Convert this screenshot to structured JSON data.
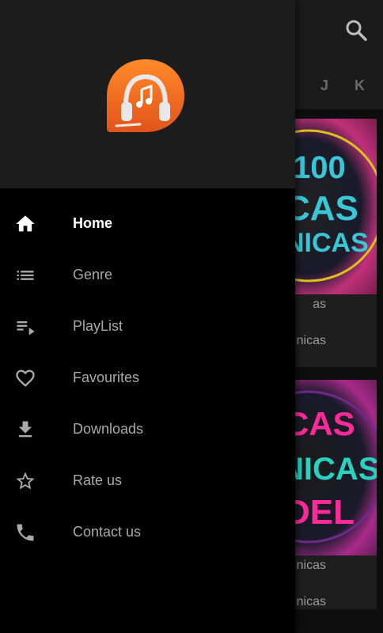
{
  "background": {
    "alphabet": [
      "J",
      "K"
    ],
    "cards": [
      {
        "art_text": "100\nCAS\nNICAS",
        "title": "as",
        "subtitle": "nicas"
      },
      {
        "art_text": "CAS\nNICAS\nDEL",
        "title": "nicas",
        "subtitle": "nicas"
      }
    ]
  },
  "drawer": {
    "nav": [
      {
        "label": "Home",
        "icon": "home-icon",
        "active": true
      },
      {
        "label": "Genre",
        "icon": "list-icon",
        "active": false
      },
      {
        "label": "PlayList",
        "icon": "playlist-icon",
        "active": false
      },
      {
        "label": "Favourites",
        "icon": "heart-icon",
        "active": false
      },
      {
        "label": "Downloads",
        "icon": "download-icon",
        "active": false
      },
      {
        "label": "Rate us",
        "icon": "star-icon",
        "active": false
      },
      {
        "label": "Contact us",
        "icon": "phone-icon",
        "active": false
      }
    ]
  },
  "colors": {
    "accent": "#f26a1b",
    "drawer_bg": "#000000",
    "header_bg": "#1c1c1c",
    "label_inactive": "#a9a9a9",
    "label_active": "#ffffff"
  }
}
